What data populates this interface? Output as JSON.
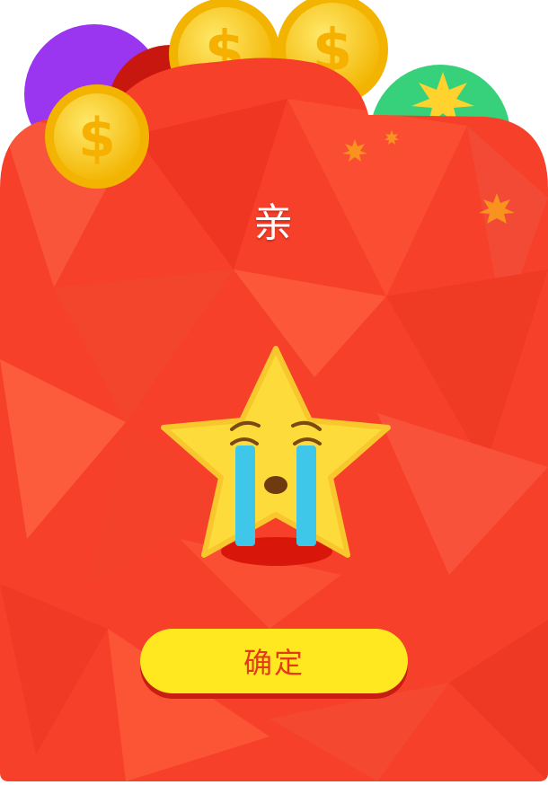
{
  "dialog": {
    "title": "亲",
    "confirm_label": "确定"
  },
  "icons": {
    "coin": "dollar-coin-icon",
    "mascot": "crying-star-icon",
    "sparkle": "sparkle-icon"
  },
  "colors": {
    "envelope": "#f6402a",
    "coin_gold": "#fdd400",
    "star_yellow": "#fddb3a",
    "tears": "#3ec7e8",
    "button": "#ffe81f",
    "button_text": "#e33a17",
    "purple_ball": "#9a36ef",
    "green_ball": "#36d17a"
  }
}
